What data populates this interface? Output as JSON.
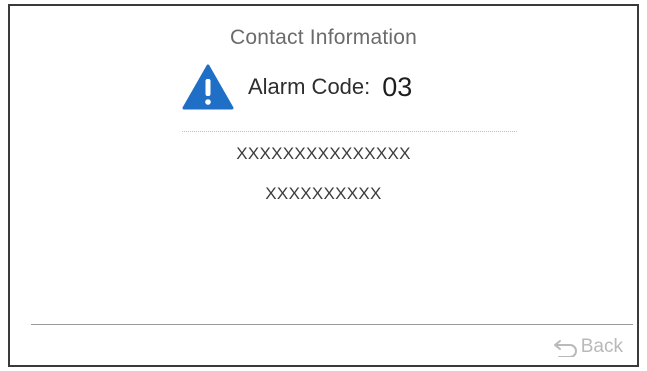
{
  "screen": {
    "title": "Contact Information"
  },
  "alarm": {
    "icon": "warning-icon",
    "icon_color": "#1f6fc7",
    "label": "Alarm Code:",
    "code": "03"
  },
  "contact": {
    "line1": "XXXXXXXXXXXXXXX",
    "line2": "XXXXXXXXXX"
  },
  "footer": {
    "back_icon": "return-arrow-icon",
    "back_label": "Back"
  }
}
